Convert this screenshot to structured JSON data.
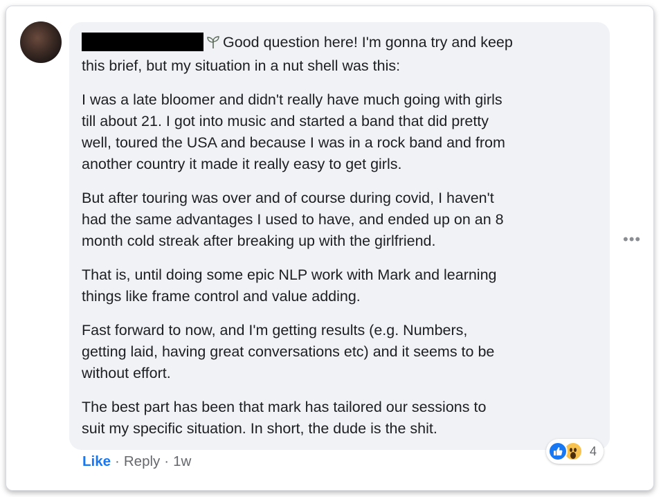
{
  "comment": {
    "first_line": "Good question here! I'm gonna try and keep",
    "first_line_cont": "this brief, but my situation in a nut shell was this:",
    "paragraphs": [
      [
        "I was a late bloomer and didn't really have much going with girls",
        "till about 21. I got into music and started a band that did pretty",
        "well, toured the USA and because I was in a rock band and from",
        "another country it made it really easy to get girls."
      ],
      [
        "But after touring was over and of course during covid, I haven't",
        "had the same advantages I used to have, and ended up on an 8",
        "month cold streak after breaking up with the girlfriend."
      ],
      [
        "That is, until doing some epic NLP work with Mark and learning",
        "things like frame control and value adding."
      ],
      [
        "Fast forward to now, and I'm getting results (e.g. Numbers,",
        "getting laid, having great conversations etc) and it seems to be",
        "without effort."
      ],
      [
        "The best part has been that mark has tailored our sessions to",
        "suit my specific situation. In short, the dude is the shit."
      ]
    ]
  },
  "reactions": {
    "icons": [
      "like-icon",
      "wow-icon"
    ],
    "count": "4"
  },
  "actions": {
    "like": "Like",
    "reply": "Reply",
    "time": "1w",
    "separator": "·"
  },
  "more": {
    "label": "•••"
  },
  "colors": {
    "bubble": "#f0f2f5",
    "link": "#1877f2",
    "meta": "#65676b",
    "text": "#1c1e21"
  }
}
